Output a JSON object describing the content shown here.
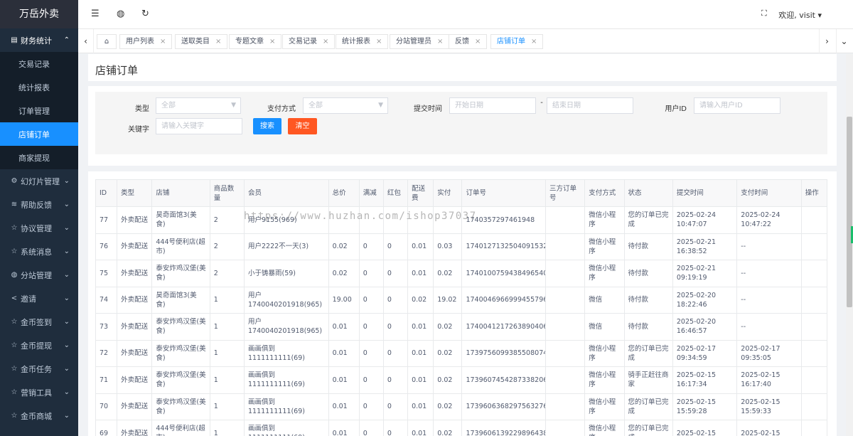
{
  "app": {
    "title": "万岳外卖"
  },
  "sidebar": {
    "items": [
      {
        "label": "财务统计",
        "icon": "list-icon",
        "open": true,
        "children": [
          {
            "label": "交易记录"
          },
          {
            "label": "统计报表"
          },
          {
            "label": "订单管理"
          },
          {
            "label": "店铺订单",
            "active": true
          },
          {
            "label": "商家提现"
          }
        ]
      },
      {
        "label": "幻灯片管理",
        "icon": "gear-icon"
      },
      {
        "label": "帮助反馈",
        "icon": "stack-icon"
      },
      {
        "label": "协议管理",
        "icon": "star-icon"
      },
      {
        "label": "系统消息",
        "icon": "star-icon"
      },
      {
        "label": "分站管理",
        "icon": "globe-icon"
      },
      {
        "label": "邀请",
        "icon": "share-icon"
      },
      {
        "label": "金币签到",
        "icon": "star-icon"
      },
      {
        "label": "金币提现",
        "icon": "star-icon"
      },
      {
        "label": "金币任务",
        "icon": "star-icon"
      },
      {
        "label": "营销工具",
        "icon": "star-icon"
      },
      {
        "label": "金币商城",
        "icon": "star-icon"
      }
    ]
  },
  "topbar": {
    "user": "欢迎, visit"
  },
  "tabs": [
    "用户列表",
    "送取类目",
    "专题文章",
    "交易记录",
    "统计报表",
    "分站管理员",
    "反馈",
    "店铺订单"
  ],
  "page": {
    "title": "店铺订单"
  },
  "search": {
    "type_label": "类型",
    "type_value": "全部",
    "pay_label": "支付方式",
    "pay_value": "全部",
    "time_label": "提交时间",
    "start_placeholder": "开始日期",
    "range_sep": "-",
    "end_placeholder": "结束日期",
    "uid_label": "用户ID",
    "uid_placeholder": "请输入用户ID",
    "kw_label": "关键字",
    "kw_placeholder": "请输入关键字",
    "search_btn": "搜索",
    "clear_btn": "清空"
  },
  "colors": {
    "accent": "#1890ff",
    "danger": "#ff5722",
    "sidebar": "#1f2d3d"
  },
  "table": {
    "headers": [
      "ID",
      "类型",
      "店铺",
      "商品数量",
      "会员",
      "总价",
      "满减",
      "红包",
      "配送费",
      "实付",
      "订单号",
      "三方订单号",
      "支付方式",
      "状态",
      "提交时间",
      "支付时间",
      "操作"
    ],
    "rows": [
      [
        "77",
        "外卖配送",
        "昊奇面馆3(美食)",
        "2",
        "用户9155(969)",
        "",
        "",
        "",
        "",
        "",
        "1740357297461948",
        "",
        "微信小程序",
        "您的订单已完成",
        "2025-02-24 10:47:07",
        "2025-02-24 10:47:22",
        ""
      ],
      [
        "76",
        "外卖配送",
        "444号便利店(超市)",
        "2",
        "用户2222不一天(3)",
        "0.02",
        "0",
        "0",
        "0.01",
        "0.03",
        "1740127132504091532",
        "",
        "微信小程序",
        "待付款",
        "2025-02-21 16:38:52",
        "--",
        ""
      ],
      [
        "75",
        "外卖配送",
        "泰安炸鸡汉堡(美食)",
        "2",
        "小于铸暴雨(59)",
        "0.02",
        "0",
        "0",
        "0.01",
        "0.02",
        "1740100759438496540",
        "",
        "微信小程序",
        "待付款",
        "2025-02-21 09:19:19",
        "--",
        ""
      ],
      [
        "74",
        "外卖配送",
        "昊奇面馆3(美食)",
        "1",
        "用户1740040201918(965)",
        "19.00",
        "0",
        "0",
        "0.02",
        "19.02",
        "1740046966999455796",
        "",
        "微信",
        "待付款",
        "2025-02-20 18:22:46",
        "--",
        ""
      ],
      [
        "73",
        "外卖配送",
        "泰安炸鸡汉堡(美食)",
        "1",
        "用户1740040201918(965)",
        "0.01",
        "0",
        "0",
        "0.01",
        "0.02",
        "1740041217263890406",
        "",
        "微信",
        "待付款",
        "2025-02-20 16:46:57",
        "--",
        ""
      ],
      [
        "72",
        "外卖配送",
        "泰安炸鸡汉堡(美食)",
        "1",
        "画画俱到1111111111(69)",
        "0.01",
        "0",
        "0",
        "0.01",
        "0.02",
        "1739756099385508074",
        "",
        "微信小程序",
        "您的订单已完成",
        "2025-02-17 09:34:59",
        "2025-02-17 09:35:05",
        ""
      ],
      [
        "71",
        "外卖配送",
        "泰安炸鸡汉堡(美食)",
        "1",
        "画画俱到1111111111(69)",
        "0.01",
        "0",
        "0",
        "0.01",
        "0.02",
        "1739607454287338206",
        "",
        "微信小程序",
        "骑手正赶往商家",
        "2025-02-15 16:17:34",
        "2025-02-15 16:17:40",
        ""
      ],
      [
        "70",
        "外卖配送",
        "泰安炸鸡汉堡(美食)",
        "1",
        "画画俱到1111111111(69)",
        "0.01",
        "0",
        "0",
        "0.01",
        "0.02",
        "1739606368297563276",
        "",
        "微信小程序",
        "您的订单已完成",
        "2025-02-15 15:59:28",
        "2025-02-15 15:59:33",
        ""
      ],
      [
        "69",
        "外卖配送",
        "444号便利店(超市)",
        "1",
        "画画俱到1111111111(69)",
        "0.01",
        "0",
        "0",
        "0.01",
        "0.02",
        "1739606139229896438",
        "",
        "微信小程序",
        "您的订单已完成",
        "2025-02-15",
        "2025-02-15",
        ""
      ]
    ]
  },
  "watermark": "https://www.huzhan.com/ishop37037"
}
